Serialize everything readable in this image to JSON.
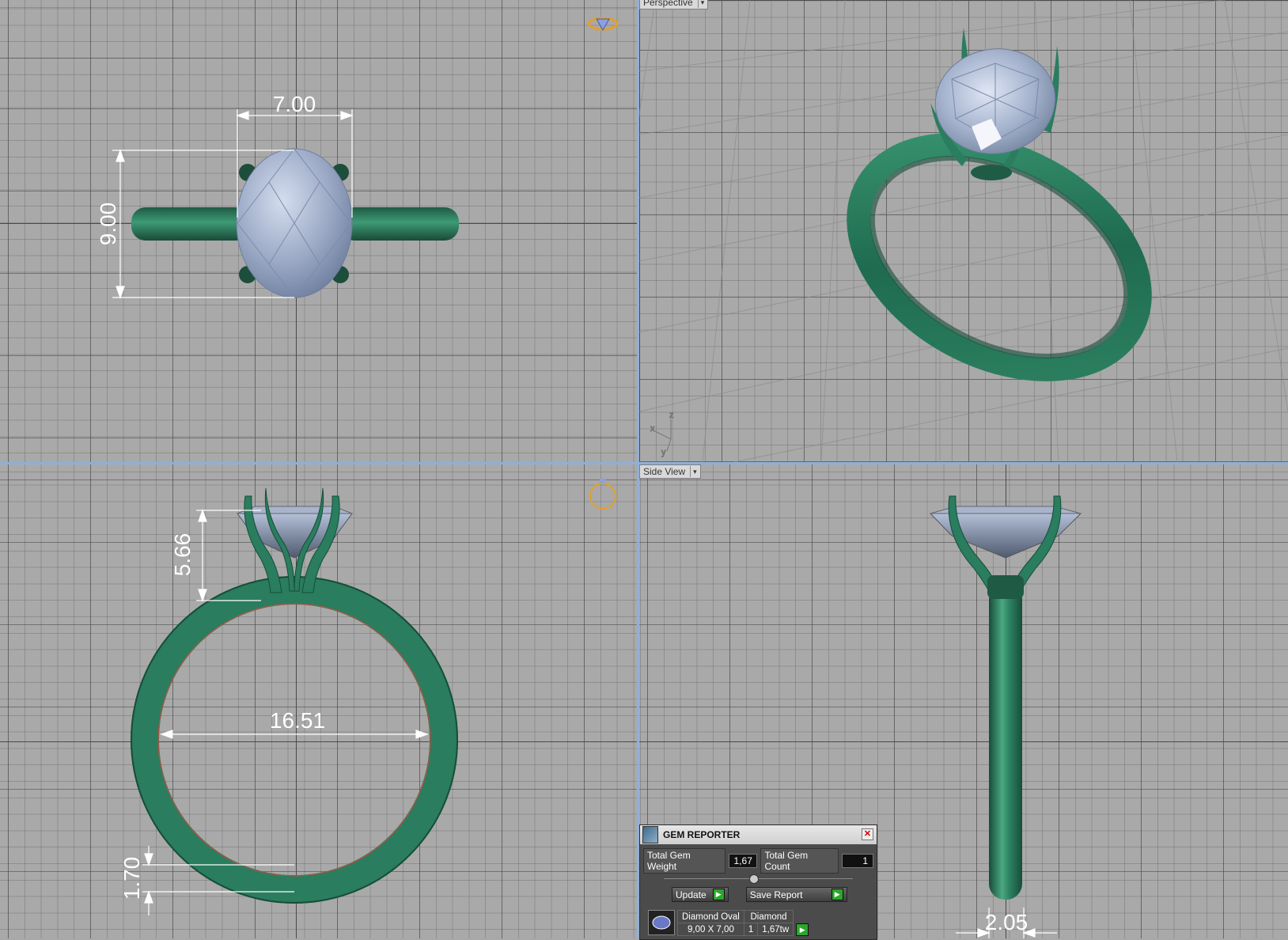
{
  "viewports": {
    "perspective_label": "Perspective",
    "side_label": "Side View"
  },
  "dimensions": {
    "top_width": "7.00",
    "top_height": "9.00",
    "front_height": "5.66",
    "front_inner_diameter": "16.51",
    "front_band_thickness": "1.70",
    "side_band_width": "2.05"
  },
  "axes": {
    "x": "x",
    "y": "y",
    "z": "z"
  },
  "gem_reporter": {
    "title": "GEM REPORTER",
    "total_weight_label": "Total Gem Weight",
    "total_weight_value": "1,67",
    "total_count_label": "Total Gem Count",
    "total_count_value": "1",
    "update_label": "Update",
    "save_report_label": "Save Report",
    "rows": [
      {
        "name": "Diamond Oval",
        "size": "9,00 X 7,00",
        "material": "Diamond",
        "count": "1",
        "weight": "1,67tw"
      }
    ]
  },
  "colors": {
    "metal": "#2e7a5c",
    "gem": "#9aa8c4",
    "grid_bg": "#a9a9a9",
    "separator": "#8fb0d8"
  }
}
